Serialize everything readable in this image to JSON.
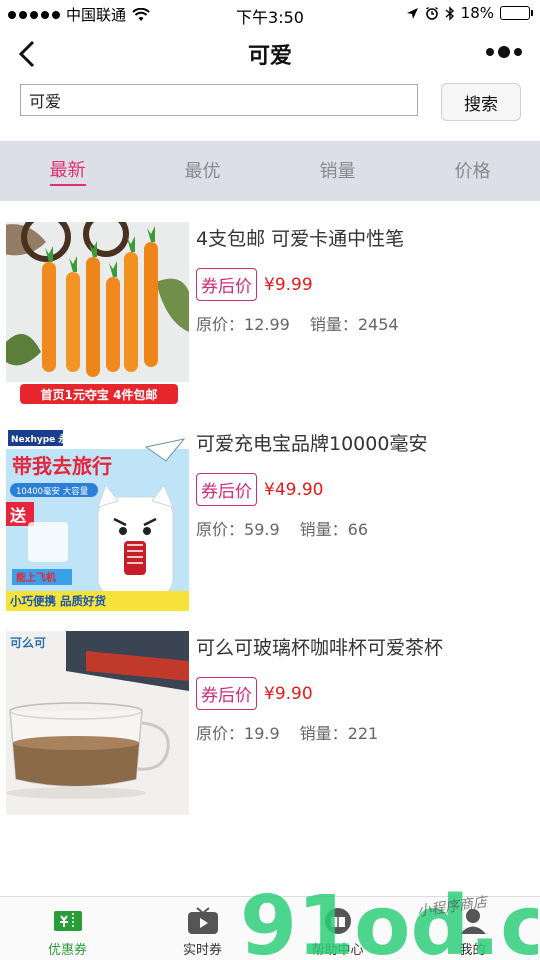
{
  "status_bar": {
    "carrier": "中国联通",
    "time": "下午3:50",
    "battery": "18%",
    "battery_level": 0.18
  },
  "navbar": {
    "title": "可爱"
  },
  "search": {
    "value": "可爱",
    "button_label": "搜索"
  },
  "sort_tabs": [
    {
      "label": "最新",
      "active": true
    },
    {
      "label": "最优",
      "active": false
    },
    {
      "label": "销量",
      "active": false
    },
    {
      "label": "价格",
      "active": false
    }
  ],
  "products": [
    {
      "title": "4支包邮 可爱卡通中性笔",
      "coupon_label": "券后价",
      "price": "¥9.99",
      "original_price_label": "原价：",
      "original_price": "12.99",
      "sales_label": "销量：",
      "sales": "2454",
      "banner_text": "首页1元夺宝 4件包邮"
    },
    {
      "title": "可爱充电宝品牌10000毫安",
      "coupon_label": "券后价",
      "price": "¥49.90",
      "original_price_label": "原价：",
      "original_price": "59.9",
      "sales_label": "销量：",
      "sales": "66",
      "brand_text": "Nexhype 永恒",
      "headline_text": "带我去旅行",
      "capacity_text": "10400毫安 大容量",
      "gift_text": "送",
      "flight_text": "能上飞机",
      "footer_text": "小巧便携 品质好货"
    },
    {
      "title": "可么可玻璃杯咖啡杯可爱茶杯",
      "coupon_label": "券后价",
      "price": "¥9.90",
      "original_price_label": "原价：",
      "original_price": "19.9",
      "sales_label": "销量：",
      "sales": "221",
      "brand_text": "可么可"
    }
  ],
  "tabbar": [
    {
      "label": "优惠券",
      "icon": "coupon-icon",
      "active": true
    },
    {
      "label": "实时券",
      "icon": "tv-icon",
      "active": false
    },
    {
      "label": "帮助中心",
      "icon": "help-icon",
      "active": false
    },
    {
      "label": "我的",
      "icon": "user-icon",
      "active": false
    }
  ],
  "watermark": {
    "text": "91od.com",
    "handwriting": "小程序商店"
  },
  "colors": {
    "accent_pink": "#e0306e",
    "price_red": "#e31a1a",
    "coupon_border": "#d02a7a",
    "tab_bg": "#dcdfe8",
    "active_green": "#2a9d3a",
    "watermark_green": "#2fcf7a",
    "watermark_orange": "#f7a21b"
  }
}
